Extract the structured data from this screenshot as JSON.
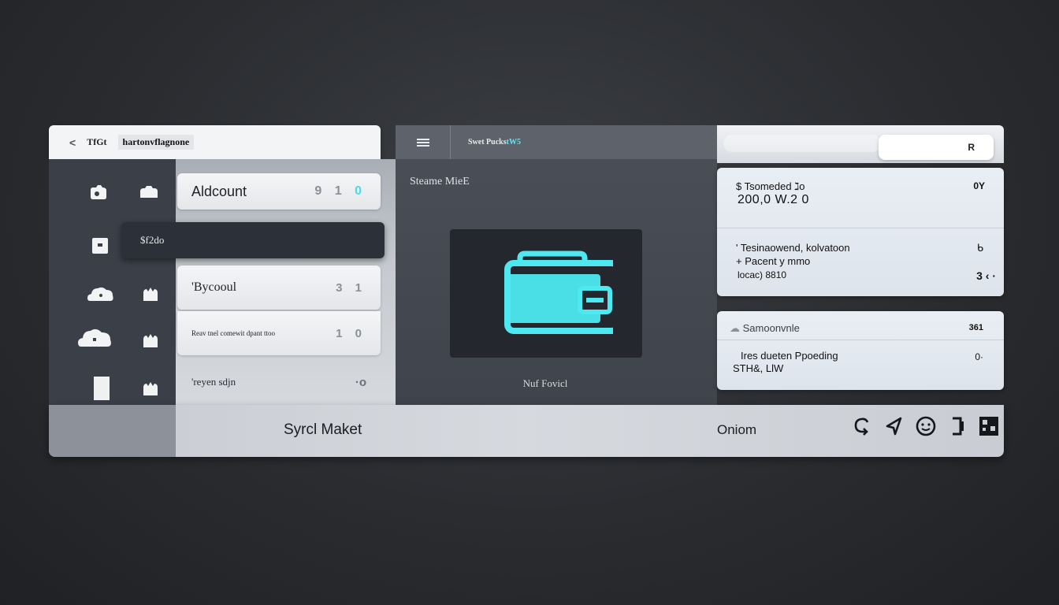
{
  "left_header": {
    "back_glyph": "<",
    "title": "TfGt",
    "subtitle": "hartonvflagnone"
  },
  "list": {
    "items": [
      {
        "label": "Aldcount",
        "value_pre": "9 1",
        "value_hl": "0"
      },
      {
        "label": "'Bycooul",
        "value_pre": "3 1",
        "value_hl": ""
      },
      {
        "label": "Reav tnel comewit dpant ttoo",
        "value_pre": "1 0",
        "value_hl": ""
      },
      {
        "label": "'reyen sdjn",
        "value_pre": "·o",
        "value_hl": ""
      }
    ],
    "selected_label": "$f2do"
  },
  "middle": {
    "breadcrumb": "Swet Pucks",
    "breadcrumb_accent": "tW5",
    "section_title": "Steame MieE",
    "caption": "Nuf Fovicl",
    "accent_color": "#4de8f0"
  },
  "right": {
    "top_button": "R",
    "card1": {
      "title": "$ Tsomeded ℷo",
      "amount": "200,0 W.2  0",
      "amount_right": "0Y",
      "line1": "' Tesinaowend, kolvatoon",
      "line2": "+ Pacent y mmo",
      "line3": "locac) 8810",
      "line1_right": "ᑲ",
      "line3_right": "3 ‹ ·"
    },
    "card2": {
      "header": "Samoonvnle",
      "header_right": "361",
      "line1": "Ires dueten Ppoeding",
      "line2": "STH&, LlW",
      "line1_right": "0·"
    }
  },
  "bottom": {
    "title": "Syrcl Maket",
    "status": "Oniom",
    "icons": [
      "cloud-sync-icon",
      "send-icon",
      "smile-icon",
      "device-icon",
      "grid-icon"
    ]
  }
}
